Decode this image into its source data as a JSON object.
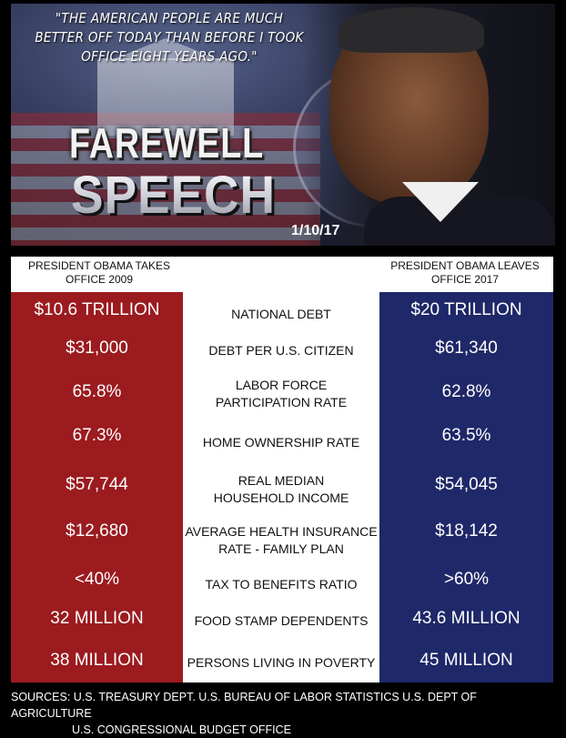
{
  "banner": {
    "quote": "\"THE AMERICAN PEOPLE ARE MUCH BETTER OFF TODAY THAN BEFORE I TOOK OFFICE EIGHT YEARS AGO.\"",
    "title_line1": "FAREWELL",
    "title_line2": "SPEECH",
    "date": "1/10/17"
  },
  "table": {
    "left_header": "PRESIDENT OBAMA TAKES OFFICE 2009",
    "right_header": "PRESIDENT OBAMA LEAVES OFFICE 2017",
    "rows": [
      {
        "left": "$10.6 TRILLION",
        "label": "NATIONAL DEBT",
        "right": "$20 TRILLION"
      },
      {
        "left": "$31,000",
        "label": "DEBT PER U.S. CITIZEN",
        "right": "$61,340"
      },
      {
        "left": "65.8%",
        "label": "LABOR FORCE PARTICIPATION RATE",
        "right": "62.8%"
      },
      {
        "left": "67.3%",
        "label": "HOME OWNERSHIP RATE",
        "right": "63.5%"
      },
      {
        "left": "$57,744",
        "label": "REAL MEDIAN HOUSEHOLD INCOME",
        "right": "$54,045"
      },
      {
        "left": "$12,680",
        "label": "AVERAGE HEALTH INSURANCE RATE - FAMILY PLAN",
        "right": "$18,142"
      },
      {
        "left": "<40%",
        "label": "TAX TO BENEFITS RATIO",
        "right": ">60%"
      },
      {
        "left": "32 MILLION",
        "label": "FOOD STAMP DEPENDENTS",
        "right": "43.6 MILLION"
      },
      {
        "left": "38 MILLION",
        "label": "PERSONS LIVING IN POVERTY",
        "right": "45 MILLION"
      }
    ]
  },
  "sources": {
    "line1": "SOURCES:  U.S. TREASURY DEPT.  U.S. BUREAU OF LABOR STATISTICS  U.S. DEPT OF AGRICULTURE",
    "line2": "U.S. CONGRESSIONAL BUDGET OFFICE"
  },
  "colors": {
    "left_column": "#9b1b1f",
    "right_column": "#1f2868",
    "middle_column": "#ffffff"
  }
}
